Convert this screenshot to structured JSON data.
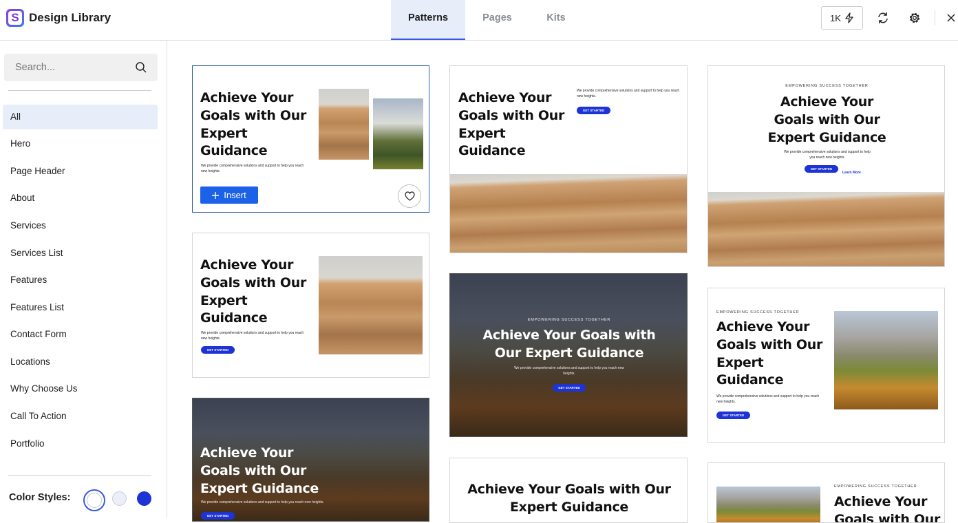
{
  "header": {
    "logo_letter": "S",
    "app_title": "Design Library",
    "tabs": [
      {
        "label": "Patterns",
        "active": true
      },
      {
        "label": "Pages",
        "active": false
      },
      {
        "label": "Kits",
        "active": false
      }
    ],
    "credits_label": "1K",
    "icons": [
      "bolt-icon",
      "refresh-icon",
      "gear-icon",
      "close-icon"
    ]
  },
  "sidebar": {
    "search_placeholder": "Search...",
    "categories": [
      {
        "label": "All",
        "active": true
      },
      {
        "label": "Hero"
      },
      {
        "label": "Page Header"
      },
      {
        "label": "About"
      },
      {
        "label": "Services"
      },
      {
        "label": "Services List"
      },
      {
        "label": "Features"
      },
      {
        "label": "Features List"
      },
      {
        "label": "Contact Form"
      },
      {
        "label": "Locations"
      },
      {
        "label": "Why Choose Us"
      },
      {
        "label": "Call To Action"
      },
      {
        "label": "Portfolio"
      }
    ],
    "color_styles_label": "Color Styles:",
    "color_swatches": [
      "#ffffff",
      "#eceef8",
      "#1e33d6"
    ]
  },
  "pattern": {
    "headline": "Achieve Your Goals with Our Expert Guidance",
    "headline_lines_4": [
      "Achieve Your",
      "Goals with Our",
      "Expert",
      "Guidance"
    ],
    "headline_lines_3": [
      "Achieve Your",
      "Goals with Our",
      "Expert Guidance"
    ],
    "headline_lines_2": [
      "Achieve Your Goals with",
      "Our Expert Guidance"
    ],
    "headline_lines_2b": [
      "Achieve Your Goals with Our",
      "Expert Guidance"
    ],
    "headline_partial": [
      "Achieve Your",
      "Goals with Our"
    ],
    "body": "We provide comprehensive solutions and support to help you reach new heights.",
    "eyebrow": "EMPOWERING SUCCESS TOGETHER",
    "cta": "GET STARTED",
    "learn_more": "Learn More",
    "accent_color": "#1e33d6"
  },
  "card_actions": {
    "insert_label": "Insert",
    "favorite_icon": "heart-icon",
    "button_color": "#1c62e8"
  }
}
